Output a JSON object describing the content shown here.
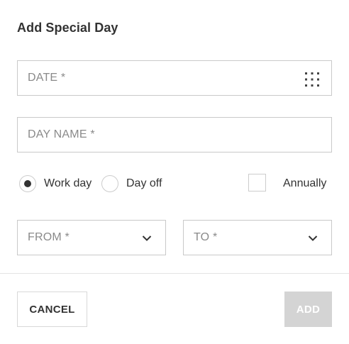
{
  "dialog": {
    "title": "Add Special Day"
  },
  "form": {
    "date_placeholder": "DATE *",
    "day_name_placeholder": "DAY NAME *",
    "day_type": {
      "options": [
        {
          "label": "Work day",
          "selected": true
        },
        {
          "label": "Day off",
          "selected": false
        }
      ]
    },
    "annually": {
      "label": "Annually",
      "checked": false
    },
    "from_placeholder": "FROM *",
    "to_placeholder": "TO *"
  },
  "icons": {
    "date": "calendar-icon",
    "select": "chevron-down-icon"
  },
  "actions": {
    "cancel_label": "CANCEL",
    "add_label": "ADD",
    "add_disabled": true
  },
  "colors": {
    "text": "#333333",
    "placeholder": "#8a8a8a",
    "border": "#c9c9c9",
    "disabled_button": "#d4d4d4"
  }
}
